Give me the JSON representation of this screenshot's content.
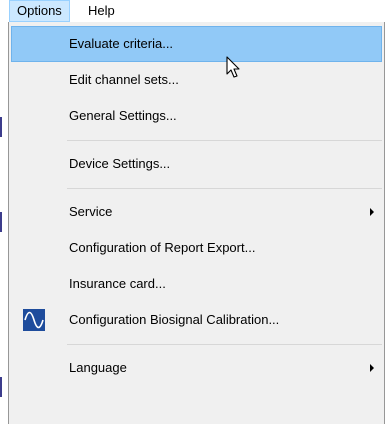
{
  "menubar": {
    "options_label": "Options",
    "help_label": "Help"
  },
  "menu": {
    "items": [
      {
        "label": "Evaluate criteria...",
        "highlighted": true,
        "submenu": false,
        "icon": ""
      },
      {
        "label": "Edit channel sets...",
        "highlighted": false,
        "submenu": false,
        "icon": ""
      },
      {
        "label": "General Settings...",
        "highlighted": false,
        "submenu": false,
        "icon": ""
      },
      {
        "label": "Device Settings...",
        "highlighted": false,
        "submenu": false,
        "icon": ""
      },
      {
        "label": "Service",
        "highlighted": false,
        "submenu": true,
        "icon": ""
      },
      {
        "label": "Configuration of Report Export...",
        "highlighted": false,
        "submenu": false,
        "icon": ""
      },
      {
        "label": "Insurance card...",
        "highlighted": false,
        "submenu": false,
        "icon": ""
      },
      {
        "label": "Configuration Biosignal Calibration...",
        "highlighted": false,
        "submenu": false,
        "icon": "sine-wave-icon"
      },
      {
        "label": "Language",
        "highlighted": false,
        "submenu": true,
        "icon": ""
      }
    ]
  },
  "colors": {
    "highlight": "#91c9f7",
    "menu_background": "#f0f0f0",
    "menubar_open": "#cce8ff",
    "icon_background": "#1e4c9c"
  }
}
